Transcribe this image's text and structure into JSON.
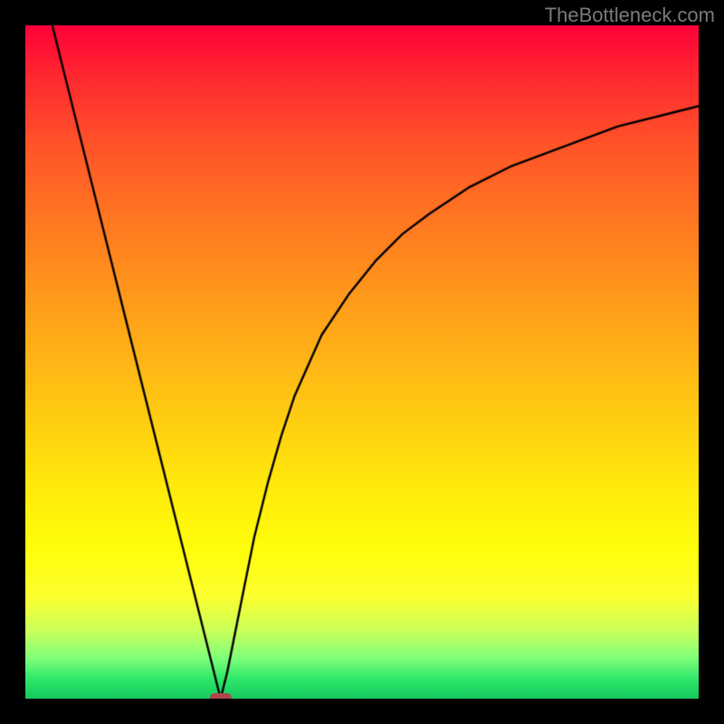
{
  "watermark": "TheBottleneck.com",
  "chart_data": {
    "type": "line",
    "title": "",
    "xlabel": "",
    "ylabel": "",
    "xlim": [
      0,
      100
    ],
    "ylim": [
      0,
      100
    ],
    "series": [
      {
        "name": "left-arm",
        "x": [
          4,
          6,
          8,
          10,
          12,
          14,
          16,
          18,
          20,
          22,
          24,
          26,
          28,
          29
        ],
        "values": [
          100,
          92,
          84,
          76,
          68,
          60,
          52,
          44,
          36,
          28,
          20,
          12,
          4,
          0
        ]
      },
      {
        "name": "right-arm",
        "x": [
          29,
          30,
          32,
          34,
          36,
          38,
          40,
          44,
          48,
          52,
          56,
          60,
          66,
          72,
          80,
          88,
          96,
          100
        ],
        "values": [
          0,
          4,
          14,
          24,
          32,
          39,
          45,
          54,
          60,
          65,
          69,
          72,
          76,
          79,
          82,
          85,
          87,
          88
        ]
      }
    ],
    "marker": {
      "name": "optimal-point",
      "x": 29,
      "y": 0,
      "width_pct": 3.2,
      "height_pct": 1.4,
      "color": "#b0444d"
    },
    "background_gradient": [
      "#ff0038",
      "#ff7a20",
      "#ffe80c",
      "#14c95e"
    ]
  }
}
